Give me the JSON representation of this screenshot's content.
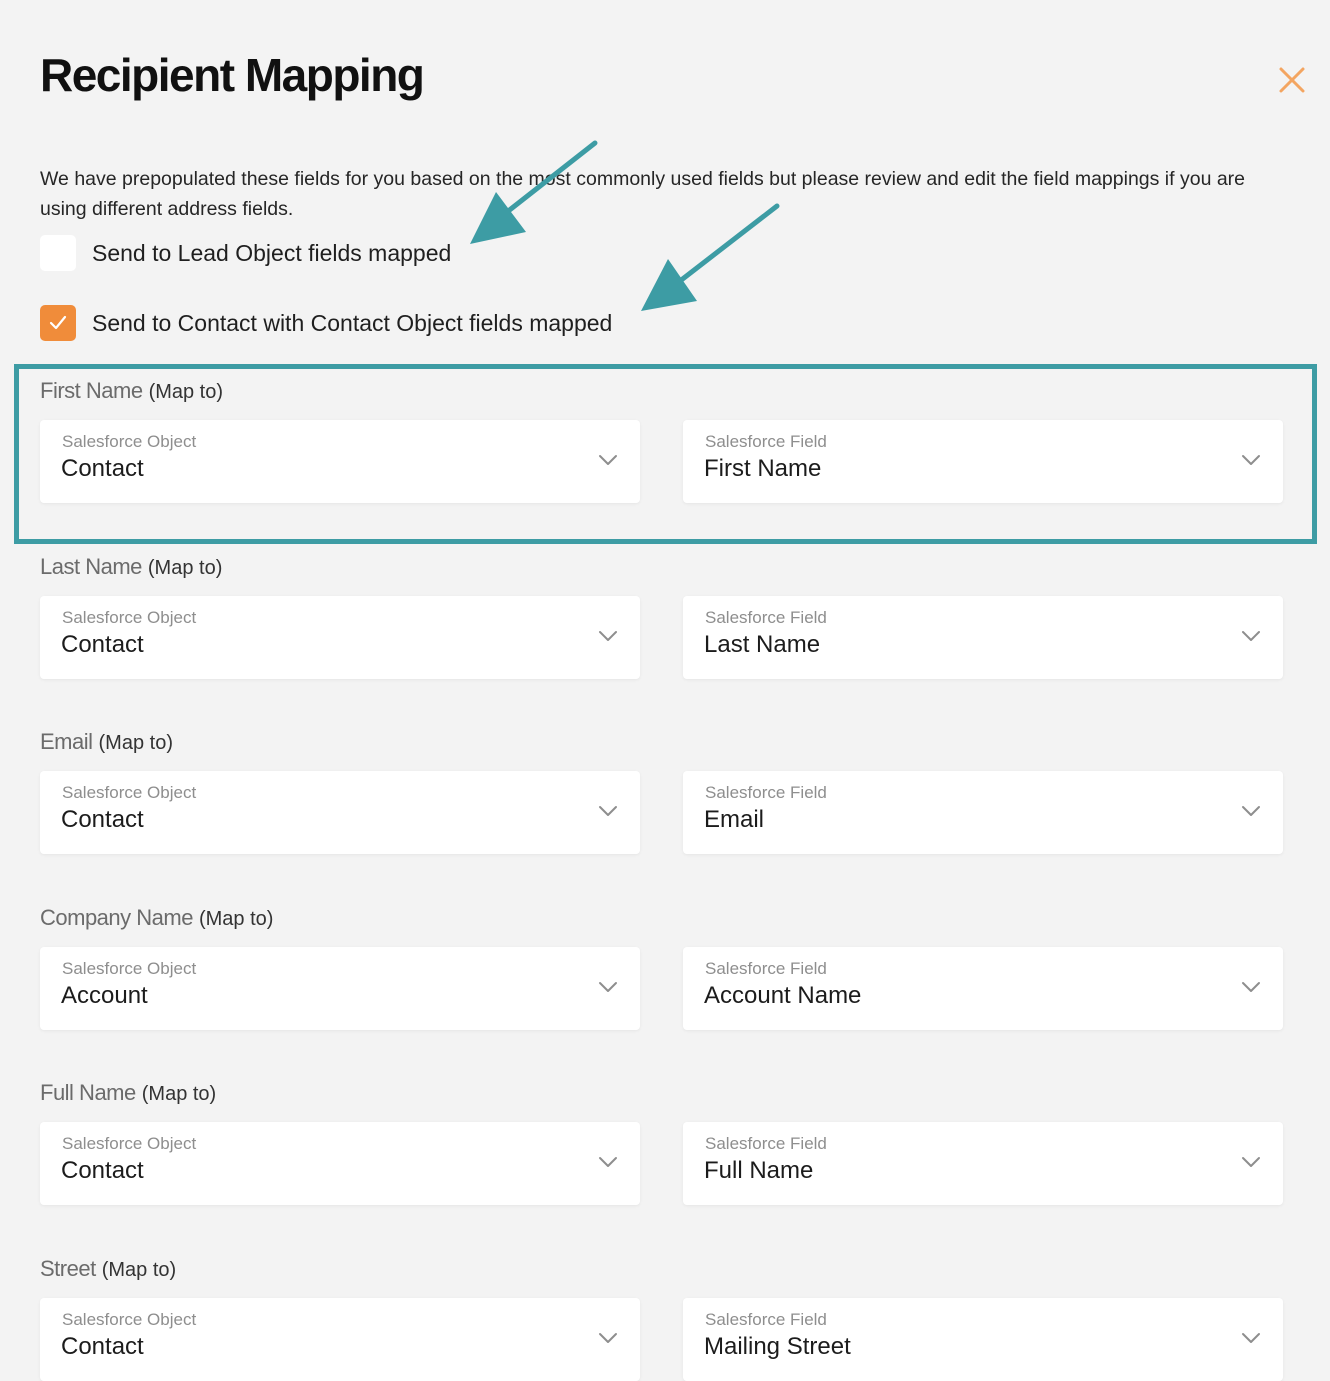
{
  "header": {
    "title": "Recipient Mapping",
    "close_icon": "close-icon"
  },
  "intro_text": "We have prepopulated these fields for you based on the most commonly used fields but please review and edit the field mappings if you are using different address fields.",
  "options": {
    "lead": {
      "label": "Send to Lead Object fields mapped",
      "checked": false
    },
    "contact": {
      "label": "Send to Contact with Contact Object fields mapped",
      "checked": true
    }
  },
  "map_to_text": "(Map to)",
  "object_label": "Salesforce Object",
  "field_label": "Salesforce Field",
  "mappings": [
    {
      "name": "First Name",
      "object": "Contact",
      "field": "First Name"
    },
    {
      "name": "Last Name",
      "object": "Contact",
      "field": "Last Name"
    },
    {
      "name": "Email",
      "object": "Contact",
      "field": "Email"
    },
    {
      "name": "Company Name",
      "object": "Account",
      "field": "Account Name"
    },
    {
      "name": "Full Name",
      "object": "Contact",
      "field": "Full Name"
    },
    {
      "name": "Street",
      "object": "Contact",
      "field": "Mailing Street"
    }
  ],
  "colors": {
    "accent_orange": "#f08c3a",
    "annotation_teal": "#3d9ca4",
    "background": "#f3f3f3"
  }
}
